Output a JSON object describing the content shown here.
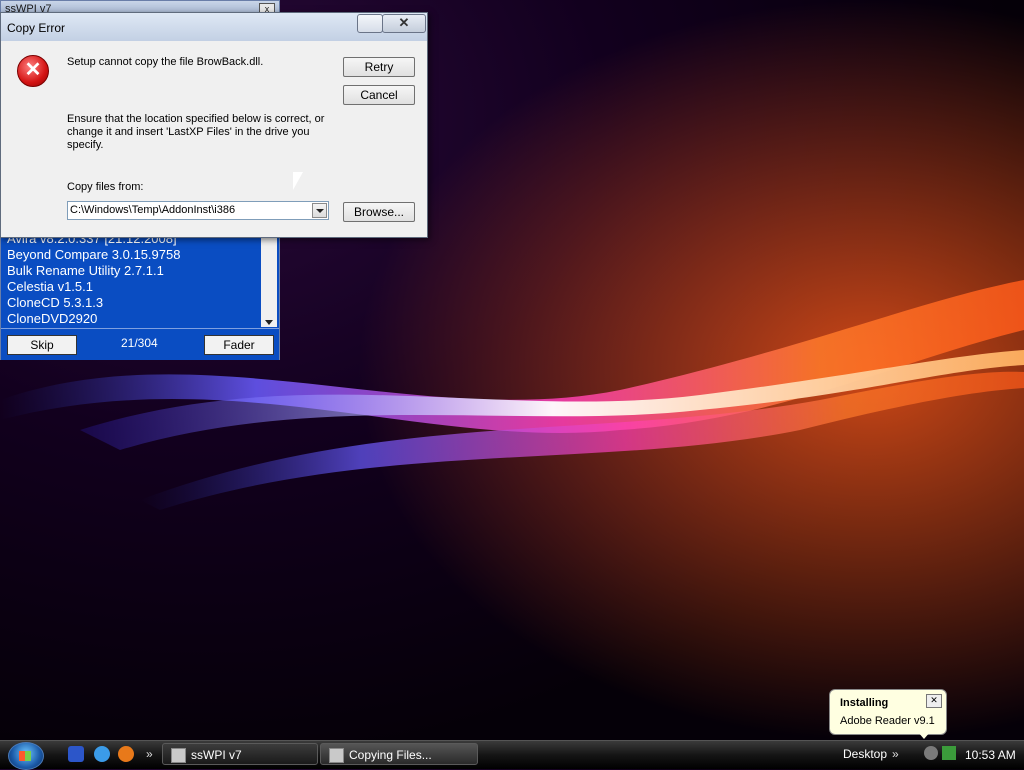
{
  "sswpi": {
    "title": "ssWPI v7",
    "close": "x",
    "list": [
      "Avira v8.2.0.337 [21.12.2008]",
      "Beyond Compare 3.0.15.9758",
      "Bulk Rename Utility 2.7.1.1",
      "Celestia v1.5.1",
      "CloneCD 5.3.1.3",
      "CloneDVD2920"
    ],
    "skip_label": "Skip",
    "counter": "21/304",
    "fader_label": "Fader"
  },
  "dialog": {
    "title": "Copy Error",
    "close": "✕",
    "message1": "Setup cannot copy the file BrowBack.dll.",
    "message2": "Ensure that the location specified below is correct, or change it and insert 'LastXP Files' in the drive you specify.",
    "copy_label": "Copy files from:",
    "path_value": "C:\\Windows\\Temp\\AddonInst\\i386",
    "retry_label": "Retry",
    "cancel_label": "Cancel",
    "browse_label": "Browse..."
  },
  "balloon": {
    "title": "Installing",
    "text": "Adobe Reader v9.1",
    "close": "✕"
  },
  "taskbar": {
    "chevron": "»",
    "tasks": [
      {
        "label": "ssWPI v7"
      },
      {
        "label": "Copying Files..."
      }
    ],
    "desktop_label": "Desktop",
    "clock": "10:53 AM"
  },
  "colors": {
    "sswpi_bg": "#0a4dc2",
    "dialog_bg": "#f0f0f0",
    "balloon_bg": "#ffffe1"
  }
}
